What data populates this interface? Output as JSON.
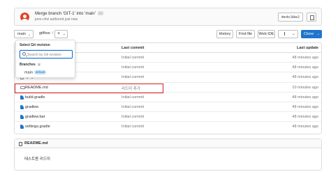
{
  "commit": {
    "title": "Merge branch 'GIT-1' into 'main'",
    "ellipsis": "...",
    "meta": "juno-choi authored just now",
    "sha": "4e4c39e2"
  },
  "toolbar": {
    "ref": "main",
    "breadcrumb": "gitflow",
    "breadcrumb_sep": "/",
    "add": "+",
    "caret": "⌄",
    "history": "History",
    "find_file": "Find file",
    "web_ide": "Web IDE",
    "clone": "Clone"
  },
  "table": {
    "col_commit": "Last commit",
    "col_update": "Last update",
    "rows": [
      {
        "name": "",
        "icon": "folder-icon",
        "commit": "Initial commit",
        "update": "48 minutes ago"
      },
      {
        "name": "",
        "icon": "folder-icon",
        "commit": "Initial commit",
        "update": "48 minutes ago"
      },
      {
        "name": ".gitignore",
        "icon": "file-icon",
        "commit": "Initial commit",
        "update": "48 minutes ago"
      },
      {
        "name": "README.md",
        "icon": "markdown-icon",
        "commit": "리드미 추가",
        "update": "10 minutes ago"
      },
      {
        "name": "build.gradle",
        "icon": "gradle-icon",
        "commit": "Initial commit",
        "update": "48 minutes ago"
      },
      {
        "name": "gradlew",
        "icon": "gradle-icon",
        "commit": "Initial commit",
        "update": "48 minutes ago"
      },
      {
        "name": "gradlew.bat",
        "icon": "gradle-icon",
        "commit": "Initial commit",
        "update": "48 minutes ago"
      },
      {
        "name": "settings.gradle",
        "icon": "gradle-icon",
        "commit": "Initial commit",
        "update": "48 minutes ago"
      }
    ]
  },
  "readme": {
    "title": "README.md",
    "body": "테스트용 리드미"
  },
  "dropdown": {
    "title": "Select Git revision",
    "search_placeholder": "Search by Git revision",
    "section": "Branches",
    "count": "1",
    "branch": "main",
    "badge": "default"
  },
  "colors": {
    "accent": "#1f75cb",
    "highlight": "#d21f1f"
  }
}
